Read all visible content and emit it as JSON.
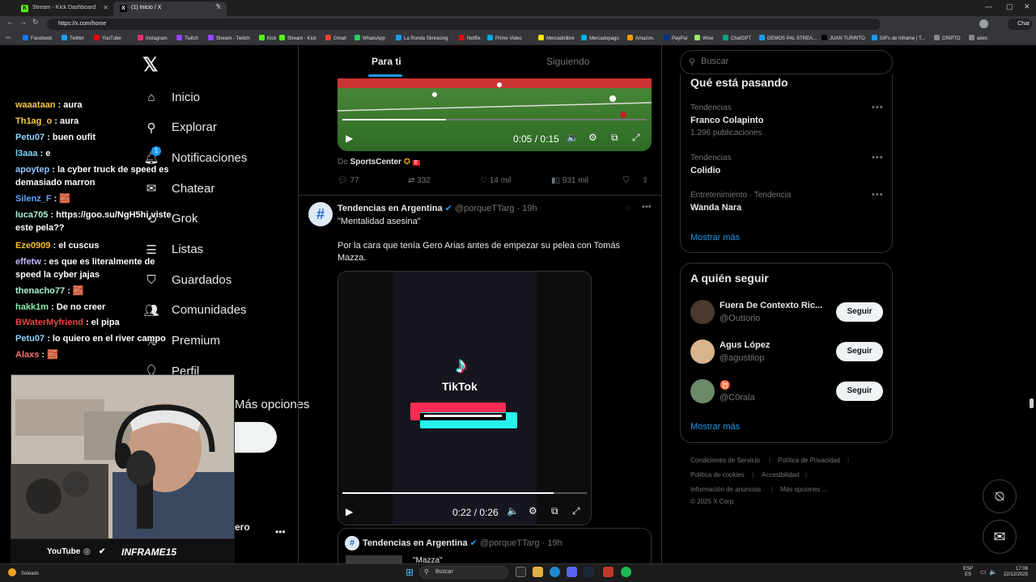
{
  "browser": {
    "tabs": [
      {
        "label": "Stream - Kick Dashboard",
        "active": false
      },
      {
        "label": "(1) Inicio / X",
        "active": true
      }
    ],
    "url": "https://x.com/home",
    "profile_label": "Chat",
    "bookmarks": [
      "Facebook",
      "Twitter",
      "YouTube",
      "Instagram",
      "Twitch",
      "Stream - Twitch",
      "Kick",
      "Stream - Kick",
      "Gmail",
      "WhatsApp",
      "La Ronda Simracing",
      "Netflix",
      "Prime Video",
      "Mercadolibre",
      "Mercadopago",
      "Amazon.",
      "PayPal",
      "Wise",
      "ChatGPT",
      "DEMOS PAL STREA...",
      "JUAN TURRITO",
      "GIFs de Inframe | T...",
      "CRIPTO",
      "aires"
    ]
  },
  "x": {
    "nav": [
      "Inicio",
      "Explorar",
      "Notificaciones",
      "Chatear",
      "Grok",
      "Listas",
      "Guardados",
      "Comunidades",
      "Premium",
      "Perfil",
      "Más opciones"
    ],
    "notif_badge": "1",
    "bottom_user_tail": "ero",
    "tabs": [
      "Para ti",
      "Siguiendo"
    ],
    "post1": {
      "time": "0:05 / 0:15",
      "source_prefix": "De",
      "source_name": "SportsCenter",
      "replies": "77",
      "reposts": "332",
      "likes": "14 mil",
      "views": "931 mil"
    },
    "post2": {
      "name": "Tendencias en Argentina",
      "handle": "@porqueTTarg · 19h",
      "quote": "\"Mentalidad asesina\"",
      "text": "Por la cara que tenía Gero Arias antes de empezar su pelea con Tomás Mazza.",
      "video_brand": "TikTok",
      "time": "0:22 / 0:26"
    },
    "post3": {
      "name": "Tendencias en Argentina",
      "handle": "@porqueTTarg · 19h",
      "text": "\"Mazza\""
    },
    "search_placeholder": "Buscar",
    "trends_title": "Qué está pasando",
    "trends": [
      {
        "category": "Tendencias",
        "name": "Franco Colapinto",
        "count": "1.296 publicaciones"
      },
      {
        "category": "Tendencias",
        "name": "Colidio",
        "count": ""
      },
      {
        "category": "Entretenimiento · Tendencia",
        "name": "Wanda Nara",
        "count": ""
      }
    ],
    "show_more": "Mostrar más",
    "follow_title": "A quién seguir",
    "follow": [
      {
        "name": "Fuera De Contexto Ric...",
        "handle": "@OutIorio",
        "button": "Seguir"
      },
      {
        "name": "Agus López",
        "handle": "@agustilop",
        "button": "Seguir"
      },
      {
        "name": "♉",
        "handle": "@C0rala",
        "button": "Seguir"
      }
    ],
    "footer": [
      "Condiciones de Servicio",
      "|",
      "Política de Privacidad",
      "|",
      "Política de cookies",
      "|",
      "Accesibilidad",
      "|",
      "Información de anuncios",
      "|",
      "Más opciones ...",
      "© 2025 X Corp."
    ]
  },
  "stream": {
    "chat": [
      {
        "user": "waaataan",
        "color": "#f5c84a",
        "msg": " : aura"
      },
      {
        "user": "Th1ag_o",
        "color": "#f5c84a",
        "msg": " : aura"
      },
      {
        "user": "Petu07",
        "color": "#8fd3ff",
        "msg": " : buen oufit"
      },
      {
        "user": "l3aaa",
        "color": "#7dd3fc",
        "msg": " : e"
      },
      {
        "user": "apoytep",
        "color": "#93c5fd",
        "msg": " : la cyber truck de speed es demasiado marron"
      },
      {
        "user": "Silenz_F",
        "color": "#60a5fa",
        "msg": " : 🧱"
      },
      {
        "user": "luca705",
        "color": "#a7f3d0",
        "msg": " : https://goo.su/NgH5hi viste este pela??"
      },
      {
        "user": "Eze0909",
        "color": "#fbbf24",
        "msg": " : el cuscus"
      },
      {
        "user": "effetw",
        "color": "#c4b5fd",
        "msg": " : es que es literalmente de speed la cyber jajas"
      },
      {
        "user": "thenacho77",
        "color": "#a7f3d0",
        "msg": " : 🧱"
      },
      {
        "user": "hakk1m",
        "color": "#86efac",
        "msg": " : De no creer"
      },
      {
        "user": "BWaterMyfriend",
        "color": "#ef4444",
        "msg": " : el pipa"
      },
      {
        "user": "Petu07",
        "color": "#8fd3ff",
        "msg": " : lo quiero en el river campo"
      },
      {
        "user": "Alaxs",
        "color": "#f87171",
        "msg": " : 🧱"
      }
    ],
    "socials_youtube": "YouTube",
    "brand": "INFRAME15"
  },
  "taskbar": {
    "weather": "Soleado",
    "search_placeholder": "Buscar",
    "lang": "ESP",
    "lang_sub": "ES",
    "time": "17:08",
    "date": "22/12/2025"
  }
}
